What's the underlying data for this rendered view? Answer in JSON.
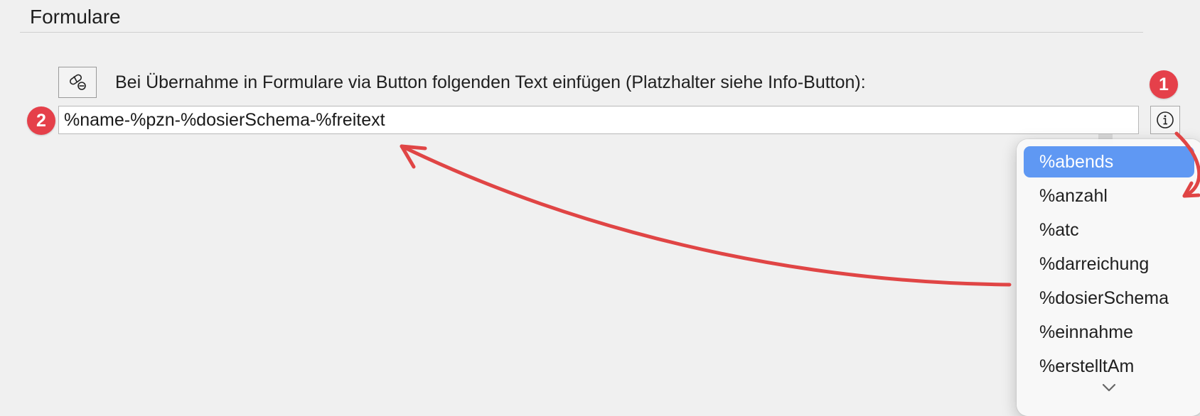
{
  "section": {
    "title": "Formulare"
  },
  "form": {
    "label": "Bei Übernahme in Formulare via Button folgenden Text einfügen (Platzhalter siehe Info-Button):",
    "value": "%name-%pzn-%dosierSchema-%freitext",
    "pill_icon": "pill-icon",
    "info_icon": "info-icon"
  },
  "badges": {
    "one": "1",
    "two": "2"
  },
  "dropdown": {
    "selected": "%abends",
    "items": [
      "%abends",
      "%anzahl",
      "%atc",
      "%darreichung",
      "%dosierSchema",
      "%einnahme",
      "%erstelltAm"
    ],
    "more_icon": "chevron-down-icon"
  },
  "colors": {
    "badge": "#e5404a",
    "selection": "#5f98f3",
    "annotation_arrow": "#e04545"
  }
}
